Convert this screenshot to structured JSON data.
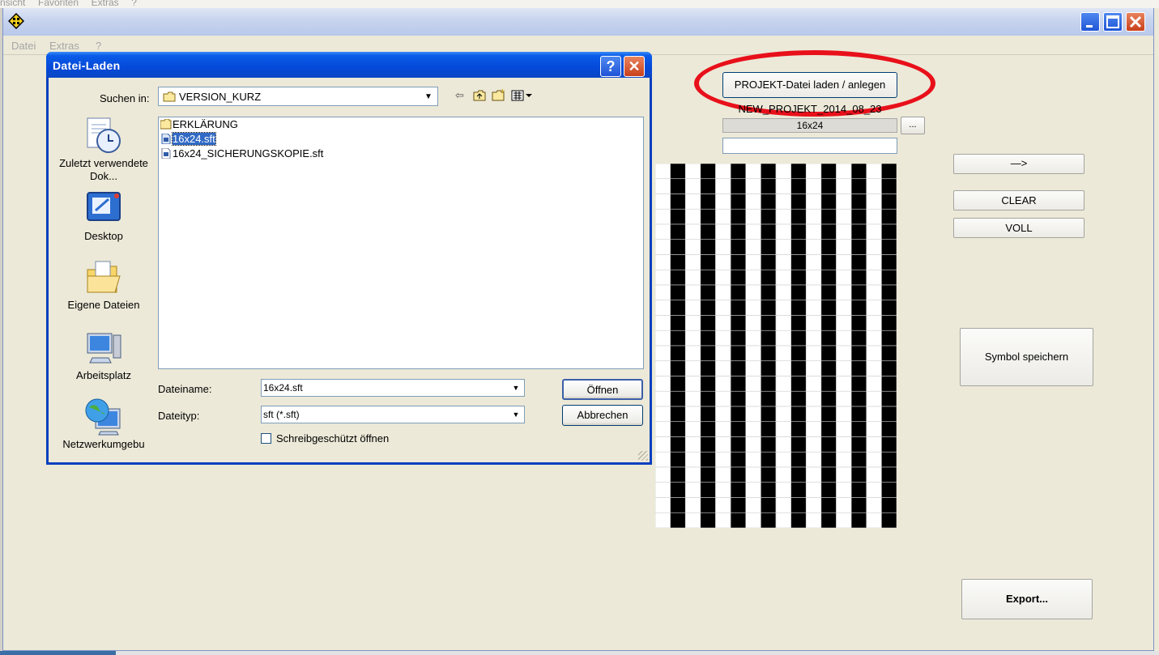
{
  "background": {
    "menu_items": [
      "nsicht",
      "Favoriten",
      "Extras",
      "?"
    ]
  },
  "main_window": {
    "menu": {
      "datei": "Datei",
      "extras": "Extras",
      "help": "?"
    }
  },
  "dialog": {
    "title": "Datei-Laden",
    "help_label": "?",
    "close_label": "✕",
    "lookin_label": "Suchen in:",
    "lookin_value": "VERSION_KURZ",
    "places": [
      {
        "label": "Zuletzt verwendete Dok...",
        "icon": "recent-documents-icon"
      },
      {
        "label": "Desktop",
        "icon": "desktop-icon"
      },
      {
        "label": "Eigene Dateien",
        "icon": "my-documents-icon"
      },
      {
        "label": "Arbeitsplatz",
        "icon": "my-computer-icon"
      },
      {
        "label": "Netzwerkumgebu",
        "icon": "network-icon"
      }
    ],
    "files": [
      {
        "name": "ERKLÄRUNG",
        "type": "folder",
        "selected": false
      },
      {
        "name": "16x24.sft",
        "type": "file",
        "selected": true
      },
      {
        "name": "16x24_SICHERUNGSKOPIE.sft",
        "type": "file",
        "selected": false
      }
    ],
    "filename_label": "Dateiname:",
    "filename_value": "16x24.sft",
    "filetype_label": "Dateityp:",
    "filetype_value": "sft (*.sft)",
    "readonly_label": "Schreibgeschützt öffnen",
    "open_label": "Öffnen",
    "cancel_label": "Abbrechen"
  },
  "panel": {
    "project_button": "PROJEKT-Datei laden / anlegen",
    "project_name": "NEW_PROJEKT_2014_08_23",
    "size_value": "16x24",
    "browse_label": "...",
    "arrow_label": "—>",
    "clear_label": "CLEAR",
    "voll_label": "VOLL",
    "save_label": "Symbol speichern",
    "export_label": "Export...",
    "highlight_color": "#e8101a"
  }
}
